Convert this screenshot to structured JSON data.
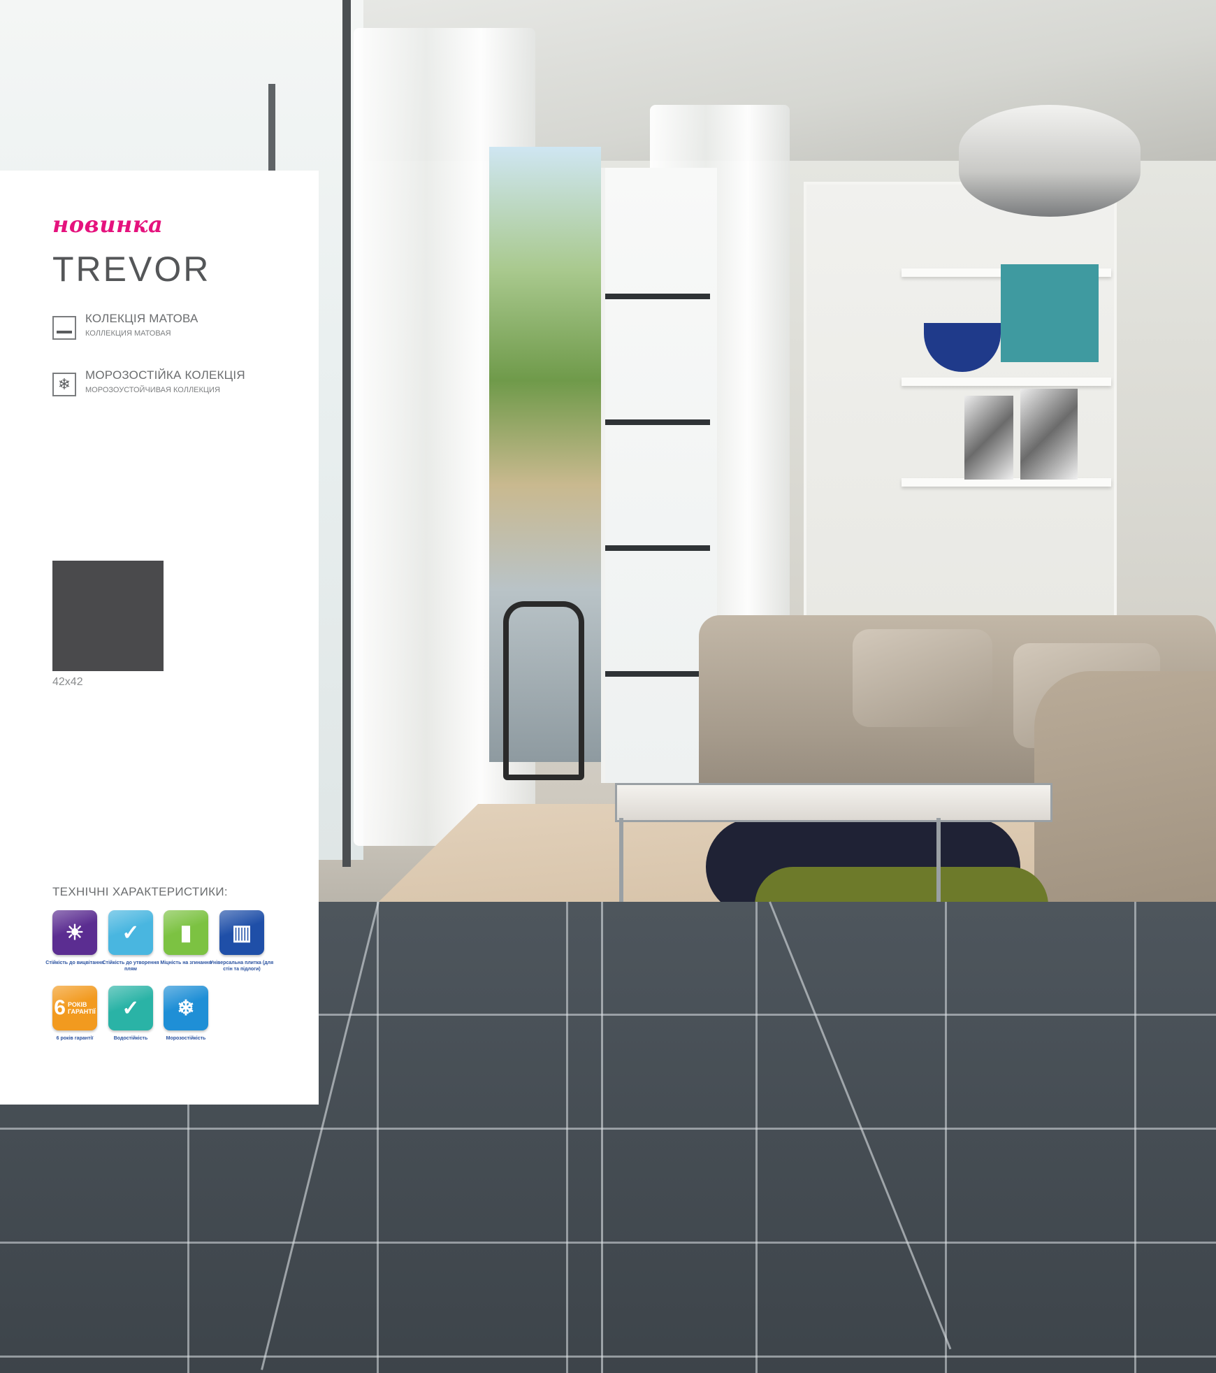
{
  "panel": {
    "badge": "новинка",
    "title": "TREVOR",
    "features": [
      {
        "icon": "matte-surface-icon",
        "label": "КОЛЕКЦІЯ МАТОВА",
        "sublabel": "КОЛЛЕКЦИЯ МАТОВАЯ"
      },
      {
        "icon": "frost-resistant-icon",
        "label": "МОРОЗОСТІЙКА КОЛЕКЦІЯ",
        "sublabel": "МОРОЗОУСТОЙЧИВАЯ КОЛЛЕКЦИЯ"
      }
    ],
    "swatch": {
      "color": "#4a4a4c",
      "size_label": "42x42"
    },
    "tech_heading": "ТЕХНІЧНІ ХАРАКТЕРИСТИКИ:",
    "tech_icons": [
      {
        "icon": "fade-resistance-icon",
        "color": "#5b2d91",
        "caption": "Стійкість до вицвітання"
      },
      {
        "icon": "stain-resistance-icon",
        "color": "#49b6e0",
        "caption": "Стійкість до утворення плям"
      },
      {
        "icon": "bending-strength-icon",
        "color": "#7cc242",
        "caption": "Міцність на згинання"
      },
      {
        "icon": "universal-tile-icon",
        "color": "#1f4fa8",
        "caption": "Універсальна плитка (для стін та підлоги)"
      },
      {
        "icon": "warranty-icon",
        "color": "#f29a1f",
        "caption": "6 років гарантії",
        "number": "6",
        "text_top": "РОКІВ",
        "text_bottom": "ГАРАНТІЇ"
      },
      {
        "icon": "water-resistance-icon",
        "color": "#2ab3a6",
        "caption": "Водостійкість"
      },
      {
        "icon": "frost-resistance-icon",
        "color": "#1f8fd6",
        "caption": "Морозостійкість"
      }
    ]
  }
}
